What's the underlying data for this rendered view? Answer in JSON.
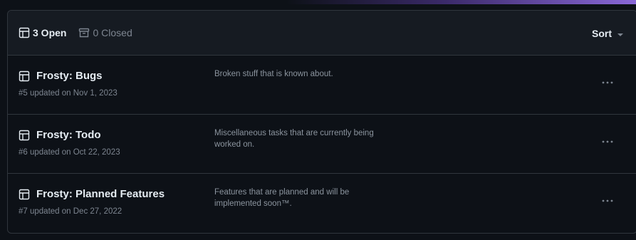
{
  "header": {
    "open_label": "3 Open",
    "closed_label": "0 Closed",
    "sort_label": "Sort"
  },
  "projects": [
    {
      "title": "Frosty: Bugs",
      "meta": "#5 updated on Nov 1, 2023",
      "description": "Broken stuff that is known about."
    },
    {
      "title": "Frosty: Todo",
      "meta": "#6 updated on Oct 22, 2023",
      "description": "Miscellaneous tasks that are currently being worked on."
    },
    {
      "title": "Frosty: Planned Features",
      "meta": "#7 updated on Dec 27, 2022",
      "description": "Features that are planned and will be implemented soon™."
    }
  ],
  "icons": {
    "project": "table-icon",
    "closed": "archive-icon",
    "more": "kebab-horizontal-icon",
    "sort_caret": "triangle-down-icon"
  },
  "colors": {
    "background": "#0d1117",
    "header_background": "#161b22",
    "border": "#30363d",
    "text_primary": "#e6edf3",
    "text_muted": "#7d8590"
  }
}
